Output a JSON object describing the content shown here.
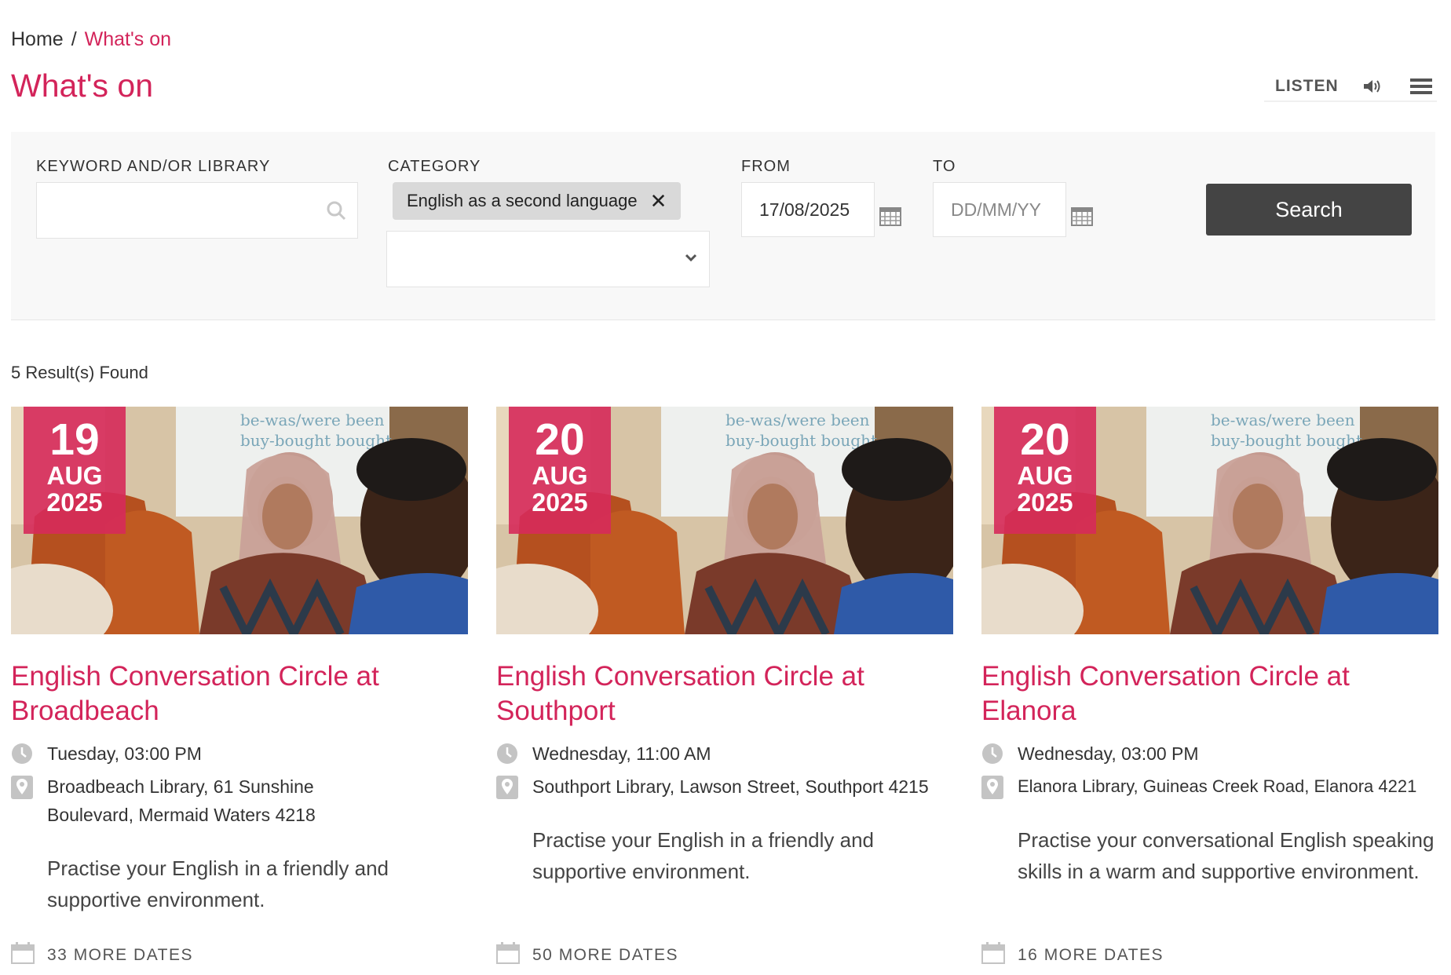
{
  "breadcrumb": {
    "home": "Home",
    "separator": "/",
    "current": "What's on"
  },
  "page": {
    "title": "What's on"
  },
  "tools": {
    "listen": "LISTEN",
    "speaker_icon": "speaker-icon",
    "menu_icon": "menu-icon"
  },
  "filters": {
    "keyword_label": "KEYWORD AND/OR LIBRARY",
    "keyword_value": "",
    "category_label": "CATEGORY",
    "category_chip": "English as a second language",
    "category_chip_remove": "✕",
    "from_label": "FROM",
    "from_value": "17/08/2025",
    "to_label": "TO",
    "to_placeholder": "DD/MM/YY",
    "search_button": "Search"
  },
  "results": {
    "count_text": "5 Result(s) Found"
  },
  "events": [
    {
      "day": "19",
      "month": "AUG",
      "year": "2025",
      "title": "English Conversation Circle at Broadbeach",
      "time": "Tuesday, 03:00 PM",
      "location": "Broadbeach Library, 61 Sunshine Boulevard, Mermaid Waters 4218",
      "description": "Practise your English in a friendly and supportive environment.",
      "more_dates": "33 MORE DATES"
    },
    {
      "day": "20",
      "month": "AUG",
      "year": "2025",
      "title": "English Conversation Circle at Southport",
      "time": "Wednesday, 11:00 AM",
      "location": "Southport Library, Lawson Street, Southport 4215",
      "description": "Practise your English in a friendly and supportive environment.",
      "more_dates": "50 MORE DATES"
    },
    {
      "day": "20",
      "month": "AUG",
      "year": "2025",
      "title": "English Conversation Circle at Elanora",
      "time": "Wednesday, 03:00 PM",
      "location": "Elanora Library, Guineas Creek Road, Elanora 4221",
      "description": "Practise your conversational English speaking skills in a warm and supportive environment.",
      "more_dates": "16 MORE DATES"
    }
  ],
  "colors": {
    "accent": "#d3245a",
    "button": "#444444",
    "panel": "#f8f8f8"
  }
}
